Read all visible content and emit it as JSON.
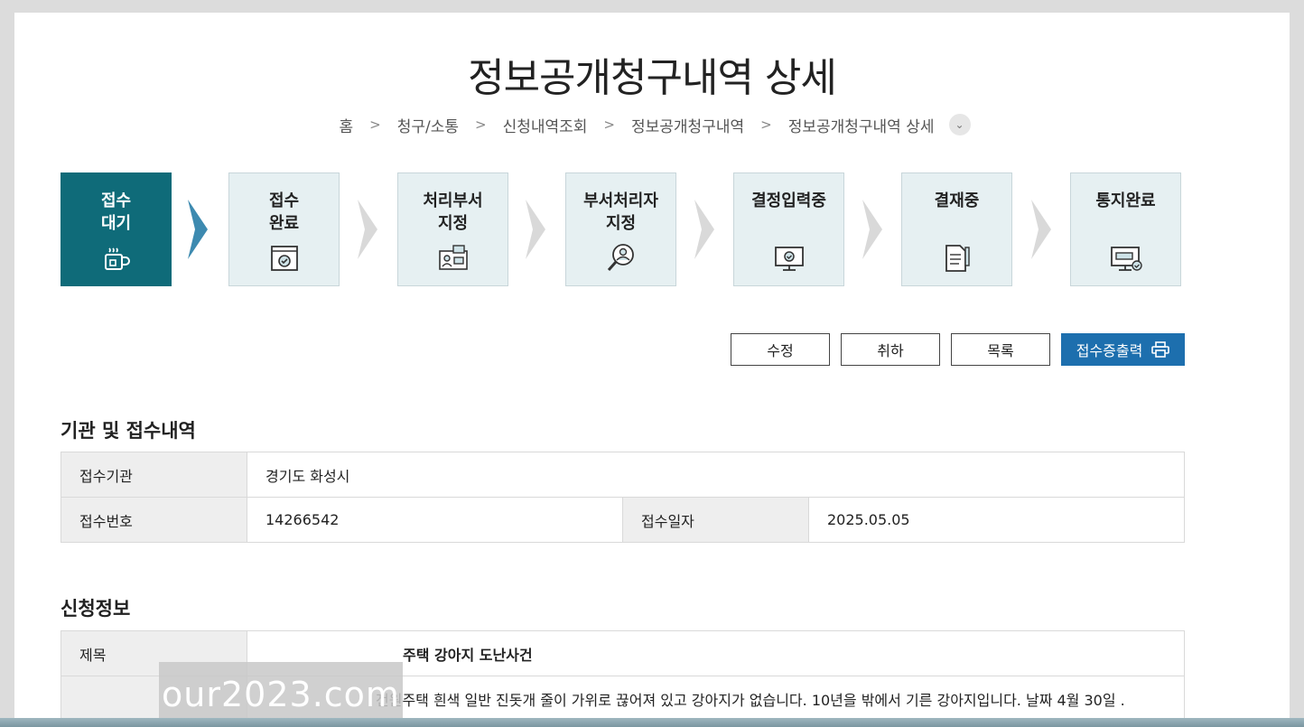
{
  "page": {
    "title": "정보공개청구내역 상세"
  },
  "breadcrumb": [
    "홈",
    "청구/소통",
    "신청내역조회",
    "정보공개청구내역",
    "정보공개청구내역 상세"
  ],
  "steps": [
    {
      "line1": "접수",
      "line2": "대기",
      "icon": "cup-icon",
      "active": true
    },
    {
      "line1": "접수",
      "line2": "완료",
      "icon": "window-check-icon",
      "active": false
    },
    {
      "line1": "처리부서",
      "line2": "지정",
      "icon": "people-monitor-icon",
      "active": false
    },
    {
      "line1": "부서처리자",
      "line2": "지정",
      "icon": "person-search-icon",
      "active": false
    },
    {
      "line1": "결정입력중",
      "line2": "",
      "icon": "monitor-check-icon",
      "active": false
    },
    {
      "line1": "결재중",
      "line2": "",
      "icon": "document-pen-icon",
      "active": false
    },
    {
      "line1": "통지완료",
      "line2": "",
      "icon": "monitor-notice-icon",
      "active": false
    }
  ],
  "buttons": {
    "edit": "수정",
    "withdraw": "취하",
    "list": "목록",
    "print": "접수증출력"
  },
  "agency_section": {
    "title": "기관 및 접수내역",
    "agency_label": "접수기관",
    "agency_value": "경기도 화성시",
    "number_label": "접수번호",
    "number_value": "14266542",
    "date_label": "접수일자",
    "date_value": "2025.05.05"
  },
  "request_section": {
    "title": "신청정보",
    "subject_label": "제목",
    "subject_value": "주택 강아지 도난사건",
    "content_value": "전원주택 흰색 일반 진돗개 줄이 가위로 끊어져 있고 강아지가 없습니다. 10년을 밖에서 기른 강아지입니다. 날짜 4월 30일 ."
  },
  "watermark": "our2023.com",
  "colors": {
    "active_step": "#0f6b79",
    "primary_button": "#1d6fae",
    "step_bg": "#e6f0f2"
  }
}
